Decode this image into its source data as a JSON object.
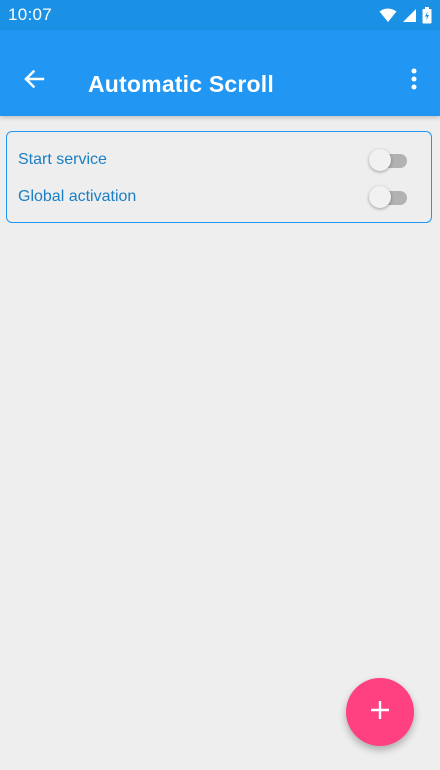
{
  "status_bar": {
    "time": "10:07",
    "icons": [
      "wifi-icon",
      "cellular-signal-icon",
      "battery-icon"
    ]
  },
  "app_bar": {
    "title": "Automatic Scroll",
    "back_icon": "arrow-back-icon",
    "menu_icon": "more-vert-icon",
    "color": "#2196f3"
  },
  "settings": {
    "items": [
      {
        "label": "Start service",
        "enabled": false
      },
      {
        "label": "Global activation",
        "enabled": false
      }
    ]
  },
  "fab": {
    "icon": "add-icon",
    "color": "#ff4081"
  }
}
